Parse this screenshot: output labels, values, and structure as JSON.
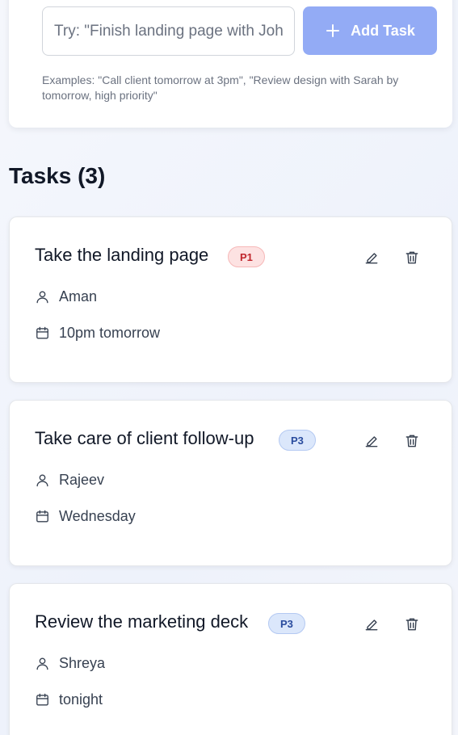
{
  "composer": {
    "input_placeholder": "Try: \"Finish landing page with John by Friday\"",
    "add_button_label": "Add Task",
    "examples_text": "Examples: \"Call client tomorrow at 3pm\", \"Review design with Sarah by tomorrow, high priority\""
  },
  "tasks_heading": "Tasks (3)",
  "tasks": [
    {
      "title": "Take the landing page",
      "priority": "P1",
      "assignee": "Aman",
      "due": "10pm tomorrow"
    },
    {
      "title": "Take care of client follow-up",
      "priority": "P3",
      "assignee": "Rajeev",
      "due": "Wednesday"
    },
    {
      "title": "Review the marketing deck",
      "priority": "P3",
      "assignee": "Shreya",
      "due": "tonight"
    }
  ],
  "colors": {
    "accent": "#93abf5",
    "p1_badge_bg": "#fde2e2",
    "p1_badge_text": "#c0262d",
    "p3_badge_bg": "#dbe7fb",
    "p3_badge_text": "#2a4c9e"
  },
  "icons": {
    "add": "plus-icon",
    "edit": "pencil-icon",
    "delete": "trash-icon",
    "assignee": "user-icon",
    "due": "calendar-icon"
  }
}
